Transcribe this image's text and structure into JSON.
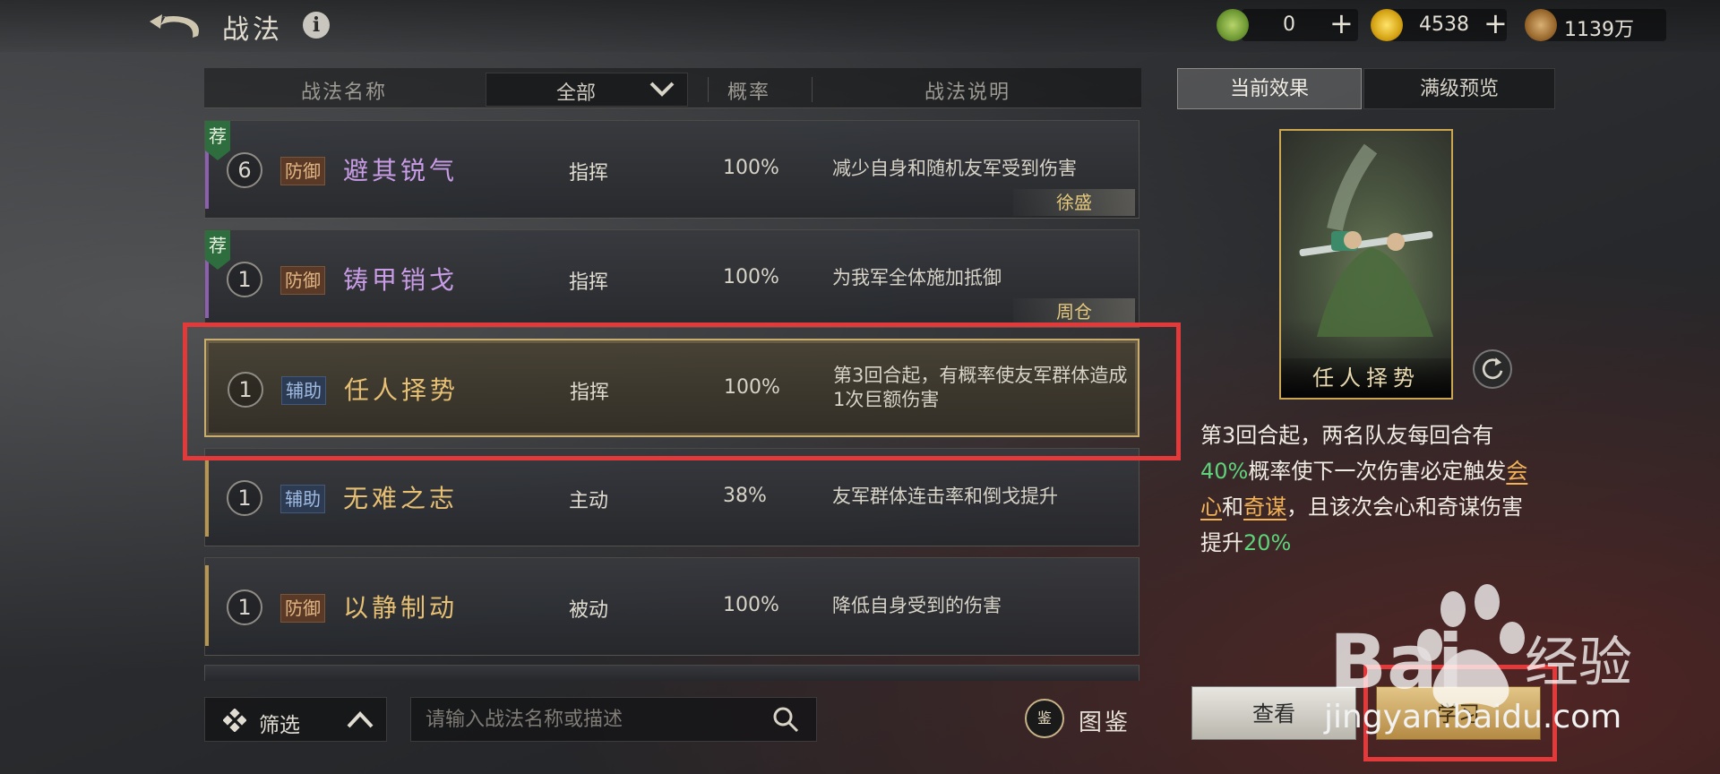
{
  "header": {
    "title": "战法",
    "info_glyph": "i"
  },
  "resources": [
    {
      "icon": "jade-coin-icon",
      "value": "0",
      "plus": "+"
    },
    {
      "icon": "gold-coin-icon",
      "value": "4538",
      "plus": "+"
    },
    {
      "icon": "copper-coin-icon",
      "value": "1139万"
    }
  ],
  "list": {
    "headers": {
      "name": "战法名称",
      "filter_selected": "全部",
      "prob": "概率",
      "desc": "战法说明"
    },
    "rows": [
      {
        "rec": "荐",
        "level": "6",
        "type": "防御",
        "name": "避其锐气",
        "kind": "指挥",
        "prob": "100%",
        "desc": "减少自身和随机友军受到伤害",
        "owner": "徐盛"
      },
      {
        "rec": "荐",
        "level": "1",
        "type": "防御",
        "name": "铸甲销戈",
        "kind": "指挥",
        "prob": "100%",
        "desc": "为我军全体施加抵御",
        "owner": "周仓"
      },
      {
        "level": "1",
        "type": "辅助",
        "name": "任人择势",
        "kind": "指挥",
        "prob": "100%",
        "desc": "第3回合起，有概率使友军群体造成1次巨额伤害"
      },
      {
        "level": "1",
        "type": "辅助",
        "name": "无难之志",
        "kind": "主动",
        "prob": "38%",
        "desc": "友军群体连击率和倒戈提升"
      },
      {
        "level": "1",
        "type": "防御",
        "name": "以静制动",
        "kind": "被动",
        "prob": "100%",
        "desc": "降低自身受到的伤害"
      }
    ]
  },
  "bottom": {
    "filter_label": "筛选",
    "search_placeholder": "请输入战法名称或描述",
    "tujian_glyph": "鉴",
    "tujian_label": "图鉴"
  },
  "detail": {
    "tabs": [
      "当前效果",
      "满级预览"
    ],
    "card_title": "任人择势",
    "effect": {
      "p1": "第3回合起，两名队友每回合有",
      "g1": "40%",
      "p2": "概率使下一次伤害必定触发",
      "o1": "会心",
      "p3": "和",
      "o2": "奇谋",
      "p4": "，且该次会心和奇谋伤害提升",
      "g2": "20%"
    },
    "btn_view": "查看",
    "btn_learn": "学习"
  },
  "watermark": {
    "brand": "Baidu经验",
    "url": "jingyan.baidu.com"
  },
  "colors": {
    "purple_name": "#c99ce6",
    "gold_name": "#e7c073",
    "highlight_green": "#5fd37b",
    "highlight_orange": "#f2b256",
    "annotation_red": "#e23a3a"
  }
}
